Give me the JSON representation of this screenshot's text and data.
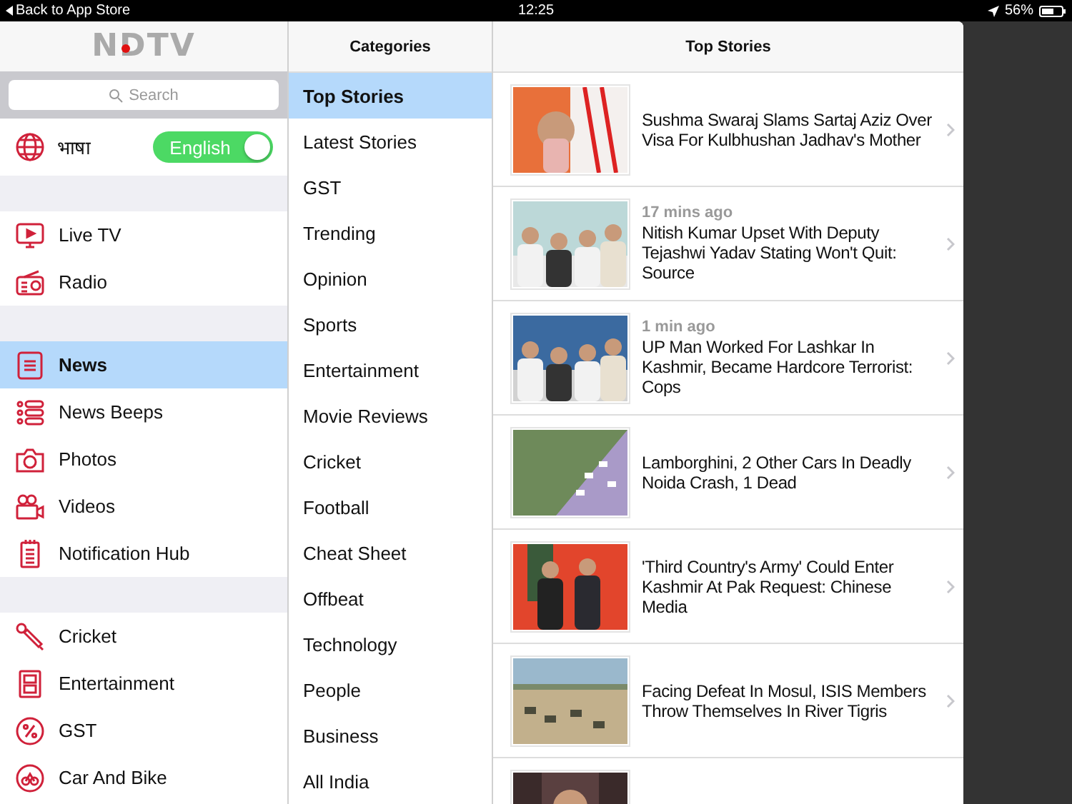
{
  "status_bar": {
    "back_label": "Back to App Store",
    "time": "12:25",
    "battery": "56%"
  },
  "sidebar": {
    "logo": "NDTV",
    "search": {
      "placeholder": "Search"
    },
    "language": {
      "label": "भाषा",
      "toggle_label": "English",
      "on": true
    },
    "sections": [
      {
        "items": [
          {
            "label": "Live TV",
            "selected": false
          },
          {
            "label": "Radio",
            "selected": false
          }
        ]
      },
      {
        "items": [
          {
            "label": "News",
            "selected": true
          },
          {
            "label": "News Beeps",
            "selected": false
          },
          {
            "label": "Photos",
            "selected": false
          },
          {
            "label": "Videos",
            "selected": false
          },
          {
            "label": "Notification Hub",
            "selected": false
          }
        ]
      },
      {
        "items": [
          {
            "label": "Cricket",
            "selected": false
          },
          {
            "label": "Entertainment",
            "selected": false
          },
          {
            "label": "GST",
            "selected": false
          },
          {
            "label": "Car And Bike",
            "selected": false
          }
        ]
      }
    ]
  },
  "categories": {
    "title": "Categories",
    "items": [
      {
        "label": "Top Stories",
        "selected": true
      },
      {
        "label": "Latest Stories",
        "selected": false
      },
      {
        "label": "GST",
        "selected": false
      },
      {
        "label": "Trending",
        "selected": false
      },
      {
        "label": "Opinion",
        "selected": false
      },
      {
        "label": "Sports",
        "selected": false
      },
      {
        "label": "Entertainment",
        "selected": false
      },
      {
        "label": "Movie Reviews",
        "selected": false
      },
      {
        "label": "Cricket",
        "selected": false
      },
      {
        "label": "Football",
        "selected": false
      },
      {
        "label": "Cheat Sheet",
        "selected": false
      },
      {
        "label": "Offbeat",
        "selected": false
      },
      {
        "label": "Technology",
        "selected": false
      },
      {
        "label": "People",
        "selected": false
      },
      {
        "label": "Business",
        "selected": false
      },
      {
        "label": "All India",
        "selected": false
      }
    ]
  },
  "stories": {
    "title": "Top Stories",
    "items": [
      {
        "kind": "picture",
        "headline": "Sushma Swaraj Slams Sartaj Aziz Over Visa For Kulbhushan Jadhav's Mother"
      },
      {
        "kind": "picture",
        "time": "17 mins ago",
        "headline": "Nitish Kumar Upset With Deputy Tejashwi Yadav Stating Won't Quit: Source"
      },
      {
        "kind": "picture",
        "time": "1 min ago",
        "headline": "UP Man Worked For Lashkar In Kashmir, Became Hardcore Terrorist: Cops"
      },
      {
        "kind": "picture",
        "headline": "Lamborghini, 2 Other Cars In Deadly Noida Crash, 1 Dead"
      },
      {
        "kind": "picture",
        "headline": "'Third Country's Army' Could Enter Kashmir At Pak Request: Chinese Media"
      },
      {
        "kind": "picture",
        "headline": "Facing Defeat In Mosul, ISIS Members Throw Themselves In River Tigris"
      },
      {
        "kind": "picture"
      }
    ]
  }
}
